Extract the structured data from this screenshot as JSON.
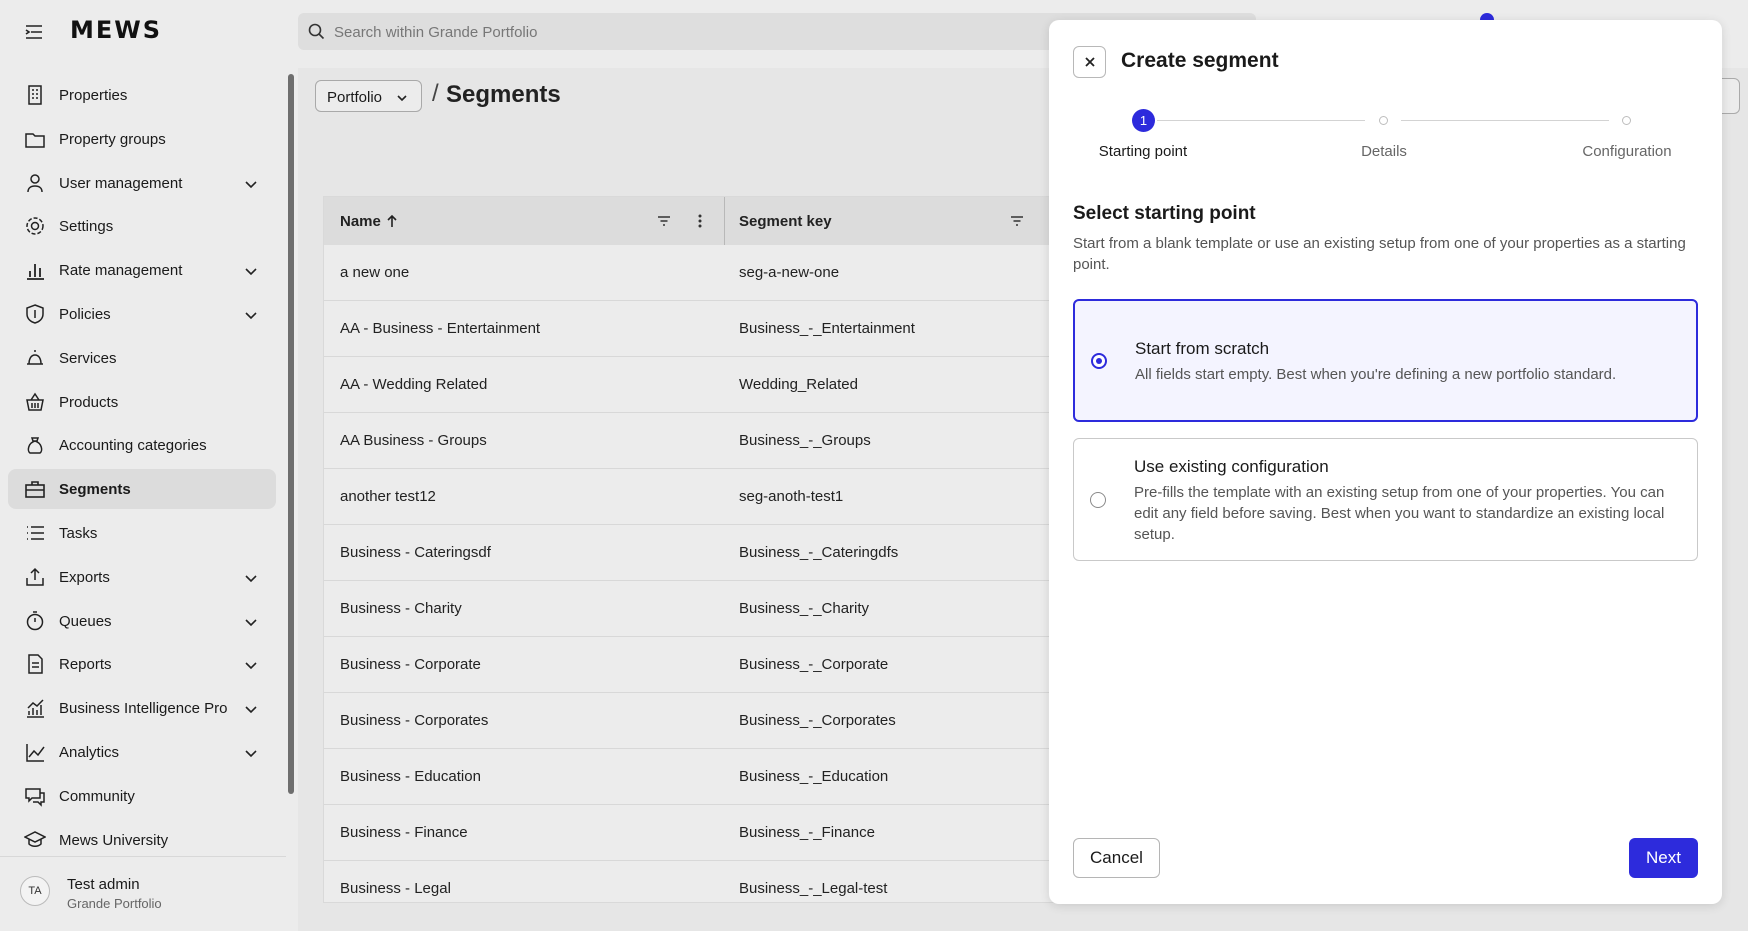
{
  "app": {
    "logo": "MEWS"
  },
  "search": {
    "placeholder": "Search within Grande Portfolio"
  },
  "sidebar": {
    "items": [
      {
        "label": "Properties",
        "icon": "building-icon",
        "expandable": false
      },
      {
        "label": "Property groups",
        "icon": "folder-icon",
        "expandable": false
      },
      {
        "label": "User management",
        "icon": "user-icon",
        "expandable": true
      },
      {
        "label": "Settings",
        "icon": "gear-icon",
        "expandable": false
      },
      {
        "label": "Rate management",
        "icon": "bar-chart-icon",
        "expandable": true
      },
      {
        "label": "Policies",
        "icon": "shield-icon",
        "expandable": true
      },
      {
        "label": "Services",
        "icon": "bell-icon",
        "expandable": false
      },
      {
        "label": "Products",
        "icon": "basket-icon",
        "expandable": false
      },
      {
        "label": "Accounting categories",
        "icon": "money-bag-icon",
        "expandable": false
      },
      {
        "label": "Segments",
        "icon": "briefcase-icon",
        "expandable": false,
        "active": true
      },
      {
        "label": "Tasks",
        "icon": "list-icon",
        "expandable": false
      },
      {
        "label": "Exports",
        "icon": "export-icon",
        "expandable": true
      },
      {
        "label": "Queues",
        "icon": "stopwatch-icon",
        "expandable": true
      },
      {
        "label": "Reports",
        "icon": "document-icon",
        "expandable": true
      },
      {
        "label": "Business Intelligence Pro",
        "icon": "trend-chart-icon",
        "expandable": true
      },
      {
        "label": "Analytics",
        "icon": "line-chart-icon",
        "expandable": true
      },
      {
        "label": "Community",
        "icon": "chat-icon",
        "expandable": false
      },
      {
        "label": "Mews University",
        "icon": "graduation-cap-icon",
        "expandable": false
      }
    ]
  },
  "user": {
    "initials": "TA",
    "name": "Test admin",
    "org": "Grande Portfolio"
  },
  "main": {
    "breadcrumb_root": "Portfolio",
    "breadcrumb_sep": "/",
    "title": "Segments",
    "table": {
      "columns": [
        "Name",
        "Segment key"
      ],
      "rows": [
        [
          "a new one",
          "seg-a-new-one"
        ],
        [
          "AA - Business - Entertainment",
          "Business_-_Entertainment"
        ],
        [
          "AA - Wedding Related",
          "Wedding_Related"
        ],
        [
          "AA Business - Groups",
          "Business_-_Groups"
        ],
        [
          "another test12",
          "seg-anoth-test1"
        ],
        [
          "Business - Cateringsdf",
          "Business_-_Cateringdfs"
        ],
        [
          "Business - Charity",
          "Business_-_Charity"
        ],
        [
          "Business - Corporate",
          "Business_-_Corporate"
        ],
        [
          "Business - Corporates",
          "Business_-_Corporates"
        ],
        [
          "Business - Education",
          "Business_-_Education"
        ],
        [
          "Business - Finance",
          "Business_-_Finance"
        ],
        [
          "Business - Legal",
          "Business_-_Legal-test"
        ]
      ]
    }
  },
  "panel": {
    "title": "Create segment",
    "steps": [
      {
        "number": "1",
        "label": "Starting point"
      },
      {
        "label": "Details"
      },
      {
        "label": "Configuration"
      }
    ],
    "section_title": "Select starting point",
    "section_desc": "Start from a blank template or use an existing setup from one of your properties as a starting point.",
    "options": [
      {
        "title": "Start from scratch",
        "desc": "All fields start empty. Best when you're defining a new portfolio standard.",
        "selected": true
      },
      {
        "title": "Use existing configuration",
        "desc": "Pre-fills the template with an existing setup from one of your properties. You can edit any field before saving. Best when you want to standardize an existing local setup.",
        "selected": false
      }
    ],
    "cancel_label": "Cancel",
    "next_label": "Next"
  },
  "colors": {
    "accent": "#2d2bdc"
  }
}
